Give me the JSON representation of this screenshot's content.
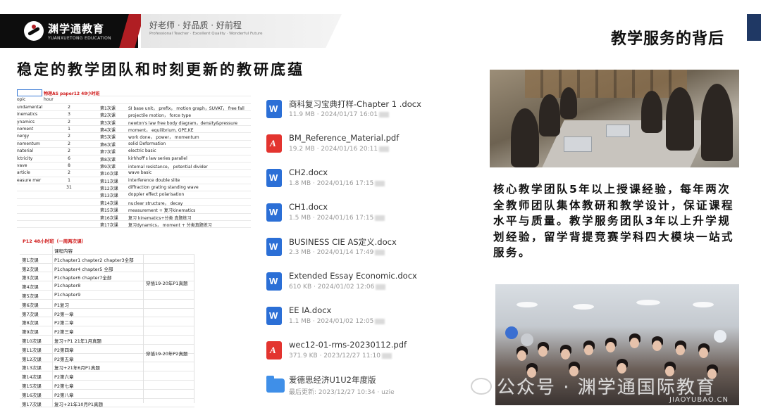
{
  "header": {
    "logo_cn": "渊学通教育",
    "logo_en": "YUANXUETONG EDUCATION",
    "slogan_cn": "好老师 · 好品质 · 好前程",
    "slogan_en": "Professional Teacher · Excellent Quality · Wonderful Future",
    "page_title": "教学服务的背后"
  },
  "section_title": "稳定的教学团队和时刻更新的教研底蕴",
  "sheet1": {
    "title": "物理AS paper12 48小时班",
    "header": [
      "opic",
      "hour"
    ],
    "rows": [
      [
        "undamental",
        "2",
        "第1次课",
        "SI base unit， prefix， motion graph，SUVAT， free fall"
      ],
      [
        "inematics",
        "3",
        "第2次课",
        "projectile motion， force type"
      ],
      [
        "ynamics",
        "2",
        "第3次课",
        "newton's law   free body diagram，density&pressure"
      ],
      [
        "noment",
        "1",
        "第4次课",
        "moment， equilibrium, GPE,KE"
      ],
      [
        "nergy",
        "2",
        "第5次课",
        "work done， power， momentum"
      ],
      [
        "nomentum",
        "2",
        "第6次课",
        "solid Deformation"
      ],
      [
        "naterial",
        "2",
        "第7次课",
        "electric basic"
      ],
      [
        "lctricity",
        "6",
        "第8次课",
        "kirhhoff's law  series parallel"
      ],
      [
        "vave",
        "8",
        "第9次课",
        "internal resistance， potential divider"
      ],
      [
        "article",
        "2",
        "第10次课",
        "wave basic"
      ],
      [
        "easure mer",
        "1",
        "第11次课",
        "interference double slite"
      ],
      [
        "",
        "31",
        "第12次课",
        "diffraction grating  standing wave"
      ],
      [
        "",
        "",
        "第13次课",
        "doppler effect  polarisation"
      ],
      [
        "",
        "",
        "第14次课",
        "nuclear structure， decay"
      ],
      [
        "",
        "",
        "第15次课",
        "measurement + 复习kinematics"
      ],
      [
        "",
        "",
        "第16次课",
        "复习 kinematics+分类 真题练习"
      ],
      [
        "",
        "",
        "第17次课",
        "复习dynamics， moment + 分类真题练习"
      ]
    ]
  },
  "sheet2": {
    "title": "P12 48小时班（一周两次课）",
    "header": [
      "",
      "课程内容"
    ],
    "rows": [
      [
        "第1次课",
        "P1chapter1 chapter2 chapter3全部"
      ],
      [
        "第2次课",
        "P1chapter4 chapter5 全部"
      ],
      [
        "第3次课",
        "P1chapter6 chapter7全部"
      ],
      [
        "第4次课",
        "P1chapter8"
      ],
      [
        "第5次课",
        "P1chapter9"
      ],
      [
        "第6次课",
        "P1复习"
      ],
      [
        "第7次课",
        "P2第一章"
      ],
      [
        "第8次课",
        "P2第二章"
      ],
      [
        "第9次课",
        "P2第三章"
      ],
      [
        "第10次课",
        "复习+P1 21年1月真题"
      ],
      [
        "第11次课",
        "P2第四章"
      ],
      [
        "第12次课",
        "P2第五章"
      ],
      [
        "第13次课",
        "复习+21年6月P1真题"
      ],
      [
        "第14次课",
        "P2第六章"
      ],
      [
        "第15次课",
        "P2第七章"
      ],
      [
        "第16次课",
        "P2第八章"
      ],
      [
        "第17次课",
        "复习+21年10月P1真题"
      ]
    ],
    "merge1": "穿插19-20年P1真题",
    "merge2": "穿插19-20年P2真题"
  },
  "files": [
    {
      "icon": "word-icon",
      "name": "商科复习宝典打样-Chapter 1 .docx",
      "meta": "11.9 MB · 2024/01/17 16:01"
    },
    {
      "icon": "pdf-icon",
      "name": "BM_Reference_Material.pdf",
      "meta": "19.2 MB · 2024/01/16 20:11"
    },
    {
      "icon": "word-icon",
      "name": "CH2.docx",
      "meta": "1.8 MB · 2024/01/16 17:15"
    },
    {
      "icon": "word-icon",
      "name": "CH1.docx",
      "meta": "1.5 MB · 2024/01/16 17:15"
    },
    {
      "icon": "word-icon",
      "name": "BUSINESS CIE AS定义.docx",
      "meta": "2.3 MB · 2024/01/14 17:49"
    },
    {
      "icon": "word-icon",
      "name": "Extended Essay Economic.docx",
      "meta": "610 KB · 2024/01/02 12:06"
    },
    {
      "icon": "word-icon",
      "name": "EE IA.docx",
      "meta": "1.1 MB · 2024/01/02 12:05"
    },
    {
      "icon": "pdf-icon",
      "name": "wec12-01-rms-20230112.pdf",
      "meta": "371.9 KB · 2023/12/27 11:10"
    },
    {
      "icon": "folder-icon",
      "name": "爱德思经济U1U2年度版",
      "meta": "最后更新: 2023/12/27 10:34 · uzie"
    }
  ],
  "description": "核心教学团队5年以上授课经验，每年两次全教师团队集体教研和教学设计，保证课程水平与质量。教学服务团队3年以上升学规划经验，留学背提竞赛学科四大模块一站式服务。",
  "watermark": {
    "text": "公众号 · 渊学通国际教育",
    "sub": "JIAOYUBAO.CN"
  }
}
